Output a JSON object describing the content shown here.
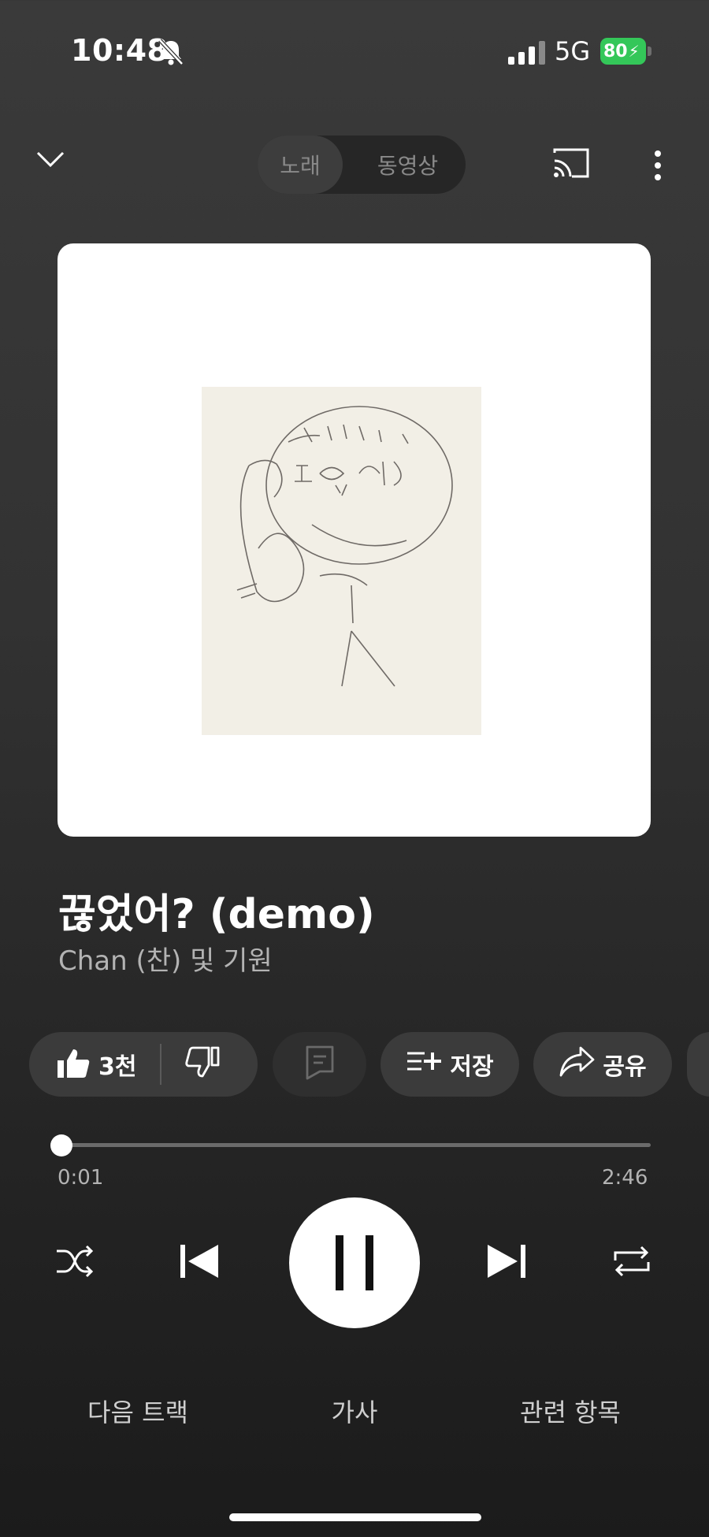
{
  "status_bar": {
    "time": "10:48",
    "network": "5G",
    "battery": "80"
  },
  "top": {
    "segments": [
      "노래",
      "동영상"
    ],
    "active_segment": "노래"
  },
  "track": {
    "title": "끊었어? (demo)",
    "artist": "Chan (찬) 및 기원"
  },
  "actions": {
    "like_count": "3천",
    "save_label": "저장",
    "share_label": "공유"
  },
  "progress": {
    "current": "0:01",
    "duration": "2:46",
    "fraction": 0.006
  },
  "tabs": {
    "next": "다음 트랙",
    "lyrics": "가사",
    "related": "관련 항목"
  },
  "colors": {
    "battery": "#34c759",
    "background": "#2b2b2b"
  }
}
